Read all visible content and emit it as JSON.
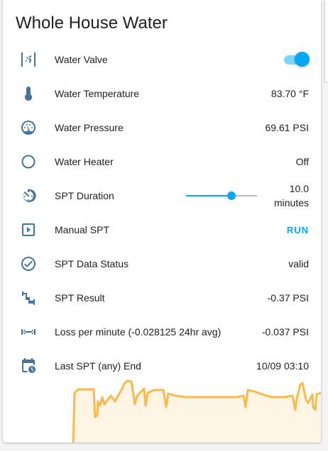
{
  "card": {
    "title": "Whole House Water"
  },
  "rows": [
    {
      "label": "Water Valve",
      "icon": "valve-icon",
      "toggle_on": true
    },
    {
      "label": "Water Temperature",
      "icon": "thermometer-icon",
      "value": "83.70 °F"
    },
    {
      "label": "Water Pressure",
      "icon": "gauge-icon",
      "value": "69.61 PSI"
    },
    {
      "label": "Water Heater",
      "icon": "circle-outline-icon",
      "value": "Off"
    },
    {
      "label": "SPT Duration",
      "icon": "timer-icon",
      "value_line1": "10.0",
      "value_line2": "minutes",
      "slider_fraction": 0.64
    },
    {
      "label": "Manual SPT",
      "icon": "play-box-icon",
      "button": "RUN"
    },
    {
      "label": "SPT Data Status",
      "icon": "check-circle-icon",
      "value": "valid"
    },
    {
      "label": "SPT Result",
      "icon": "pipe-icon",
      "value": "-0.37 PSI"
    },
    {
      "label": "Loss per minute (-0.028125 24hr avg)",
      "icon": "ruler-icon",
      "value": "-0.037 PSI"
    },
    {
      "label": "Last SPT (any) End",
      "icon": "calendar-clock-icon",
      "value": "10/09 03:10"
    }
  ],
  "colors": {
    "accent": "#03a9f4",
    "icon": "#44739e",
    "graph_line": "#f8b94d",
    "graph_fill": "#fef4e4"
  }
}
